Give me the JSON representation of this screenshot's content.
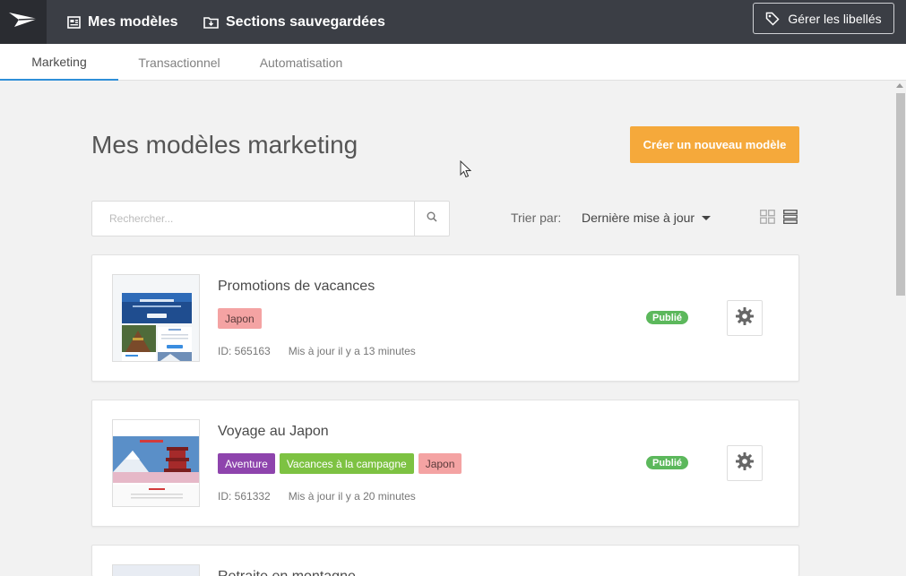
{
  "topbar": {
    "logo_icon": "paper-plane-icon",
    "nav": [
      {
        "label": "Mes modèles",
        "icon": "templates-icon"
      },
      {
        "label": "Sections sauvegardées",
        "icon": "folder-download-icon"
      }
    ],
    "labels_button": {
      "label": "Gérer les libellés",
      "icon": "tag-icon"
    }
  },
  "tabs": [
    {
      "label": "Marketing",
      "active": true
    },
    {
      "label": "Transactionnel",
      "active": false
    },
    {
      "label": "Automatisation",
      "active": false
    }
  ],
  "page": {
    "title": "Mes modèles marketing",
    "create_button": "Créer un nouveau modèle"
  },
  "search": {
    "placeholder": "Rechercher...",
    "value": ""
  },
  "sort": {
    "label": "Trier par:",
    "value": "Dernière mise à jour"
  },
  "colors": {
    "accent": "#f5a93b",
    "published": "#5cb85c",
    "tab_active": "#2f8fd8",
    "tag_japon": "#f4a3a3",
    "tag_aventure": "#8e44ad",
    "tag_vacances": "#7dc242"
  },
  "templates": [
    {
      "title": "Promotions de vacances",
      "tags": [
        {
          "label": "Japon",
          "bg": "#f4a3a3",
          "fg": "#5a3a3a"
        }
      ],
      "id_label": "ID: 565163",
      "updated": "Mis à jour il y a 13 minutes",
      "status": "Publié"
    },
    {
      "title": "Voyage au Japon",
      "tags": [
        {
          "label": "Aventure",
          "bg": "#8e44ad",
          "fg": "#ffffff"
        },
        {
          "label": "Vacances à la campagne",
          "bg": "#7dc242",
          "fg": "#ffffff"
        },
        {
          "label": "Japon",
          "bg": "#f4a3a3",
          "fg": "#5a3a3a"
        }
      ],
      "id_label": "ID: 561332",
      "updated": "Mis à jour il y a 20 minutes",
      "status": "Publié"
    },
    {
      "title": "Retraite en montagne"
    }
  ]
}
